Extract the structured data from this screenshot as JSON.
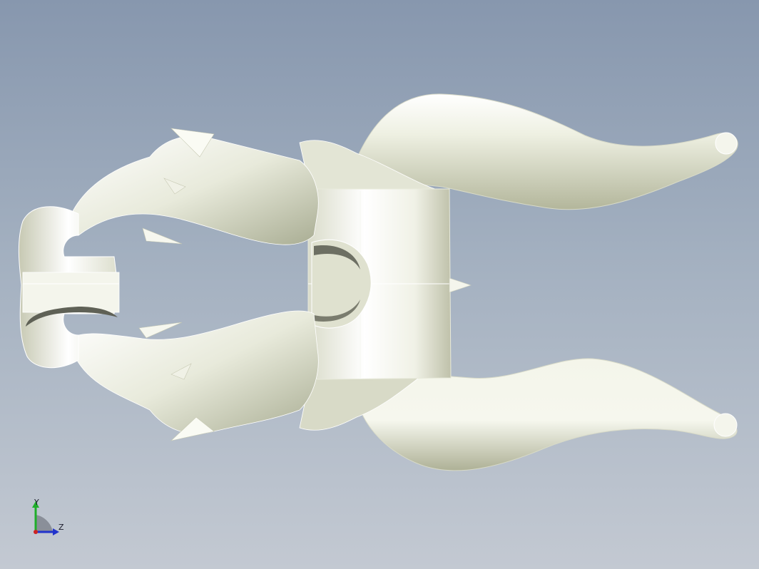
{
  "viewport": {
    "background_top": "#8797ae",
    "background_bottom": "#c3c9d2",
    "model_color": "#eceee0",
    "model_shadow": "#b9bca4",
    "model_highlight": "#ffffff",
    "edge_color": "#ffffff"
  },
  "triad": {
    "y_label": "Y",
    "z_label": "Z",
    "y_color": "#1fae2a",
    "z_color": "#2233cc",
    "x_color": "#cc2222",
    "plane_color": "#8a8f99"
  }
}
